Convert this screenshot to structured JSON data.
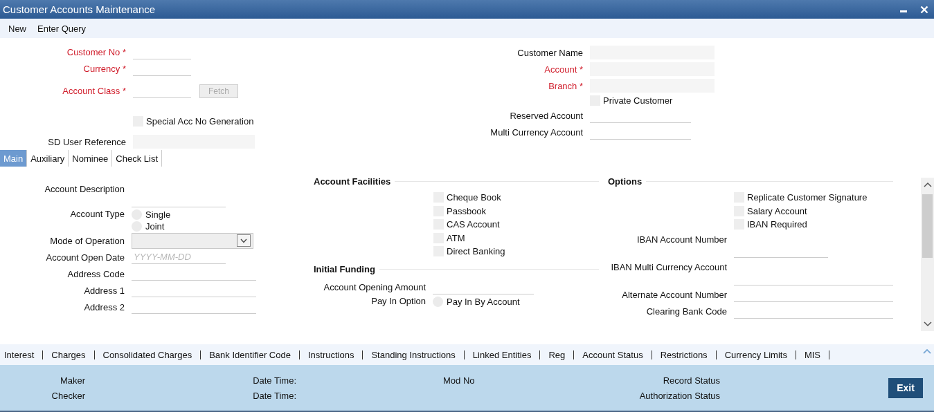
{
  "window": {
    "title": "Customer Accounts Maintenance"
  },
  "toolbar": [
    "New",
    "Enter Query"
  ],
  "header": {
    "columns": [
      {
        "sections": [
          {
            "items": [
              {
                "kind": "field",
                "label": "Customer No *",
                "required": true
              },
              {
                "kind": "field",
                "label": "Currency *",
                "required": true
              },
              {
                "kind": "field",
                "label": "Account Class *",
                "required": true,
                "button": {
                  "label": "Fetch",
                  "disabled": true
                }
              },
              {
                "kind": "checkbox",
                "label": "Special Acc No Generation",
                "checked": false
              },
              {
                "kind": "box",
                "label": "SD User Reference",
                "required": false
              }
            ]
          }
        ]
      },
      {
        "sections": [
          {
            "items": [
              {
                "kind": "box",
                "label": "Customer Name",
                "required": false
              },
              {
                "kind": "box",
                "label": "Account *",
                "required": true
              },
              {
                "kind": "box",
                "label": "Branch *",
                "required": true
              },
              {
                "kind": "checkbox",
                "label": "Private Customer",
                "checked": false
              },
              {
                "kind": "field",
                "label": "Reserved Account",
                "required": false
              },
              {
                "kind": "field",
                "label": "Multi Currency Account",
                "required": false
              }
            ]
          }
        ]
      }
    ]
  },
  "tabs": [
    {
      "label": "Main",
      "selected": true
    },
    {
      "label": "Auxiliary",
      "selected": false
    },
    {
      "label": "Nominee",
      "selected": false
    },
    {
      "label": "Check List",
      "selected": false
    }
  ],
  "main": {
    "columns": [
      {
        "sections": [
          {
            "items": [
              {
                "kind": "tall",
                "label": "Account Description",
                "required": false
              },
              {
                "kind": "radio",
                "label": "Account Type",
                "options": [
                  {
                    "label": "Single",
                    "selected": false
                  },
                  {
                    "label": "Joint",
                    "selected": false
                  }
                ]
              },
              {
                "kind": "select",
                "label": "Mode of Operation",
                "required": false
              },
              {
                "kind": "field",
                "label": "Account Open Date",
                "required": false,
                "placeholder": "YYYY-MM-DD"
              },
              {
                "kind": "field",
                "label": "Address Code",
                "required": false
              },
              {
                "kind": "field",
                "label": "Address 1",
                "required": false
              },
              {
                "kind": "field",
                "label": "Address 2",
                "required": false
              }
            ]
          }
        ]
      },
      {
        "sections": [
          {
            "title": "Account Facilities",
            "items": [
              {
                "kind": "checkbox",
                "label": "Cheque Book",
                "checked": false
              },
              {
                "kind": "checkbox",
                "label": "Passbook",
                "checked": false
              },
              {
                "kind": "checkbox",
                "label": "CAS Account",
                "checked": false
              },
              {
                "kind": "checkbox",
                "label": "ATM",
                "checked": false
              },
              {
                "kind": "checkbox",
                "label": "Direct Banking",
                "checked": false
              }
            ]
          },
          {
            "title": "Initial Funding",
            "items": [
              {
                "kind": "field",
                "label": "Account Opening Amount",
                "required": false
              },
              {
                "kind": "radio",
                "label": "Pay In Option",
                "options": [
                  {
                    "label": "Pay In By Account",
                    "selected": false
                  }
                ]
              }
            ]
          }
        ]
      },
      {
        "sections": [
          {
            "title": "Options",
            "items": [
              {
                "kind": "checkbox",
                "label": "Replicate Customer Signature",
                "checked": false
              },
              {
                "kind": "checkbox",
                "label": "Salary Account",
                "checked": false
              },
              {
                "kind": "checkbox",
                "label": "IBAN Required",
                "checked": false
              },
              {
                "kind": "tall",
                "label": "IBAN Account Number",
                "required": false
              },
              {
                "kind": "tall",
                "label": "IBAN Multi Currency Account",
                "required": false
              },
              {
                "kind": "field",
                "label": "Alternate Account Number",
                "required": false
              },
              {
                "kind": "field",
                "label": "Clearing Bank Code",
                "required": false
              }
            ]
          }
        ]
      }
    ]
  },
  "subsystems": [
    "Interest",
    "Charges",
    "Consolidated Charges",
    "Bank Identifier Code",
    "Instructions",
    "Standing Instructions",
    "Linked Entities",
    "Reg",
    "Account Status",
    "Restrictions",
    "Currency Limits",
    "MIS"
  ],
  "audit": [
    {
      "label": "Maker",
      "date": "Date Time:",
      "mod": "Mod No",
      "status": "Record Status"
    },
    {
      "label": "Checker",
      "date": "Date Time:",
      "status": "Authorization Status"
    }
  ],
  "exit_button": "Exit"
}
